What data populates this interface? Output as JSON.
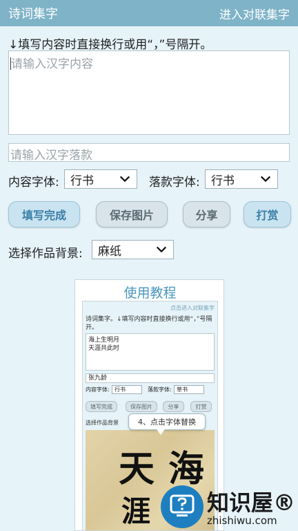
{
  "topbar": {
    "title": "诗词集字",
    "right_link": "进入对联集字"
  },
  "hint": "↓填写内容时直接换行或用“，”号隔开。",
  "content": {
    "placeholder": "请输入汉字内容"
  },
  "signature": {
    "placeholder": "请输入汉字落款"
  },
  "fonts": {
    "content_label": "内容字体:",
    "content_value": "行书",
    "signature_label": "落款字体:",
    "signature_value": "行书"
  },
  "buttons": {
    "done": "填写完成",
    "save": "保存图片",
    "share": "分享",
    "reward": "打赏"
  },
  "background": {
    "label": "选择作品背景:",
    "value": "麻纸"
  },
  "tutorial": {
    "title": "使用教程",
    "link": "点击进入对联集字",
    "hint": "诗词集字。↓填写内容时直接换行或用“，”号隔开。",
    "content_lines": [
      "海上生明月",
      "天涯共此时"
    ],
    "signature": "张九龄",
    "content_label": "内容字体:",
    "content_value": "行书",
    "signature_label": "落款字体:",
    "signature_value": "草书",
    "btn_done": "填写完成",
    "btn_save": "保存图片",
    "btn_share": "分享",
    "btn_reward": "打赏",
    "bg_label": "选择作品背景",
    "tooltip": "4、点击字体替换",
    "callig_chars": [
      "天",
      "海",
      "涯"
    ]
  },
  "watermark": {
    "brand": "知识屋®",
    "url": "zhishiwu.com"
  },
  "colors": {
    "topbar": "#7fb3c7",
    "background": "#e6f3f8",
    "accent": "#3a7fa6",
    "watermark": "#1e7fc0"
  }
}
